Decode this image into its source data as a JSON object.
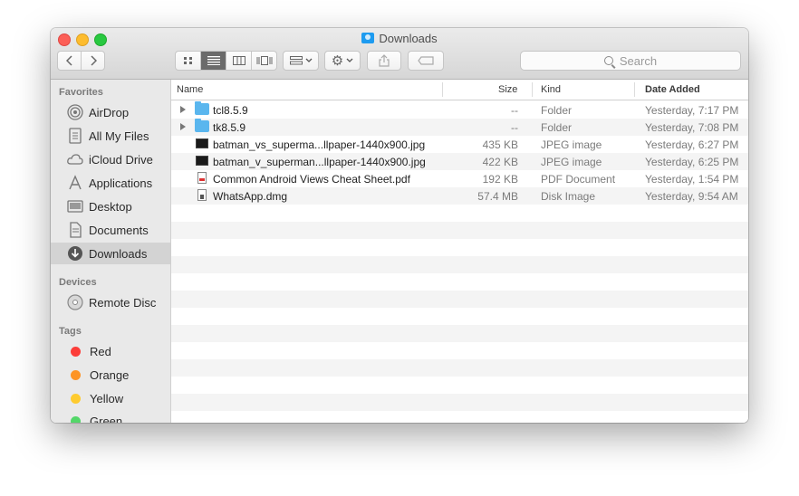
{
  "window": {
    "title": "Downloads"
  },
  "toolbar": {
    "back_icon": "chevron-left-icon",
    "forward_icon": "chevron-right-icon",
    "view_modes": [
      "icon-view",
      "list-view",
      "column-view",
      "cover-flow-view"
    ],
    "active_view": "list-view",
    "search_placeholder": "Search"
  },
  "sidebar": {
    "favorites_heading": "Favorites",
    "favorites": [
      {
        "label": "AirDrop",
        "icon": "airdrop-icon"
      },
      {
        "label": "All My Files",
        "icon": "all-files-icon"
      },
      {
        "label": "iCloud Drive",
        "icon": "cloud-icon"
      },
      {
        "label": "Applications",
        "icon": "applications-icon"
      },
      {
        "label": "Desktop",
        "icon": "desktop-icon"
      },
      {
        "label": "Documents",
        "icon": "documents-icon"
      },
      {
        "label": "Downloads",
        "icon": "downloads-icon",
        "selected": true
      }
    ],
    "devices_heading": "Devices",
    "devices": [
      {
        "label": "Remote Disc",
        "icon": "disc-icon"
      }
    ],
    "tags_heading": "Tags",
    "tags": [
      {
        "label": "Red",
        "color": "#fc3d39"
      },
      {
        "label": "Orange",
        "color": "#fd9426"
      },
      {
        "label": "Yellow",
        "color": "#fecb2f"
      },
      {
        "label": "Green",
        "color": "#53d769"
      }
    ]
  },
  "columns": {
    "name": "Name",
    "size": "Size",
    "kind": "Kind",
    "date": "Date Added"
  },
  "files": [
    {
      "name": "tcl8.5.9",
      "size": "--",
      "kind": "Folder",
      "date": "Yesterday, 7:17 PM",
      "type": "folder"
    },
    {
      "name": "tk8.5.9",
      "size": "--",
      "kind": "Folder",
      "date": "Yesterday, 7:08 PM",
      "type": "folder"
    },
    {
      "name": "batman_vs_superma...llpaper-1440x900.jpg",
      "size": "435 KB",
      "kind": "JPEG image",
      "date": "Yesterday, 6:27 PM",
      "type": "image"
    },
    {
      "name": "batman_v_superman...llpaper-1440x900.jpg",
      "size": "422 KB",
      "kind": "JPEG image",
      "date": "Yesterday, 6:25 PM",
      "type": "image"
    },
    {
      "name": "Common Android Views Cheat Sheet.pdf",
      "size": "192 KB",
      "kind": "PDF Document",
      "date": "Yesterday, 1:54 PM",
      "type": "pdf"
    },
    {
      "name": "WhatsApp.dmg",
      "size": "57.4 MB",
      "kind": "Disk Image",
      "date": "Yesterday, 9:54 AM",
      "type": "dmg"
    }
  ]
}
